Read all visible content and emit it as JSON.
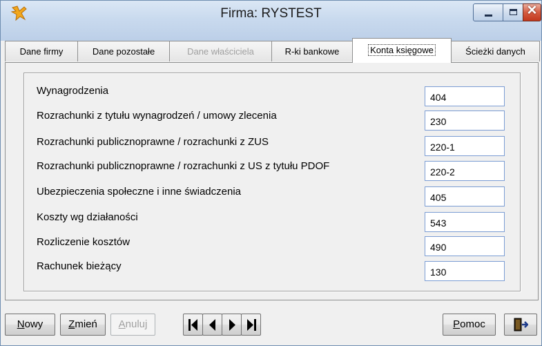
{
  "window": {
    "title": "Firma: RYSTEST",
    "close_glyph": "✕"
  },
  "tabs": [
    {
      "label": "Dane firmy",
      "state": "normal"
    },
    {
      "label": "Dane pozostałe",
      "state": "normal"
    },
    {
      "label": "Dane właściciela",
      "state": "disabled"
    },
    {
      "label": "R-ki bankowe",
      "state": "normal"
    },
    {
      "label": "Konta księgowe",
      "state": "active"
    },
    {
      "label": "Ścieżki danych",
      "state": "normal"
    }
  ],
  "accounts": [
    {
      "label": "Wynagrodzenia",
      "value": "404"
    },
    {
      "label": "Rozrachunki z tytułu wynagrodzeń / umowy zlecenia",
      "value": "230"
    },
    {
      "label": "Rozrachunki publicznoprawne / rozrachunki z ZUS",
      "value": "220-1"
    },
    {
      "label": "Rozrachunki publicznoprawne / rozrachunki z US z tytułu PDOF",
      "value": "220-2"
    },
    {
      "label": "Ubezpieczenia społeczne i inne świadczenia",
      "value": "405"
    },
    {
      "label": "Koszty wg działaności",
      "value": "543"
    },
    {
      "label": "Rozliczenie kosztów",
      "value": "490"
    },
    {
      "label": "Rachunek bieżący",
      "value": "130"
    }
  ],
  "buttons": {
    "new": {
      "mnemonic": "N",
      "rest": "owy"
    },
    "change": {
      "mnemonic": "Z",
      "rest": "mień"
    },
    "cancel": {
      "mnemonic": "A",
      "rest": "nuluj"
    },
    "help": {
      "mnemonic": "P",
      "rest": "omoc"
    }
  },
  "icons": {
    "app": "app-logo-icon",
    "first": "first-record-icon",
    "prev": "previous-record-icon",
    "next": "next-record-icon",
    "last": "last-record-icon",
    "exit": "exit-door-icon"
  },
  "colors": {
    "titlebar": "#c9daee",
    "field_border": "#7a9cd3",
    "close_button": "#c2381d"
  }
}
